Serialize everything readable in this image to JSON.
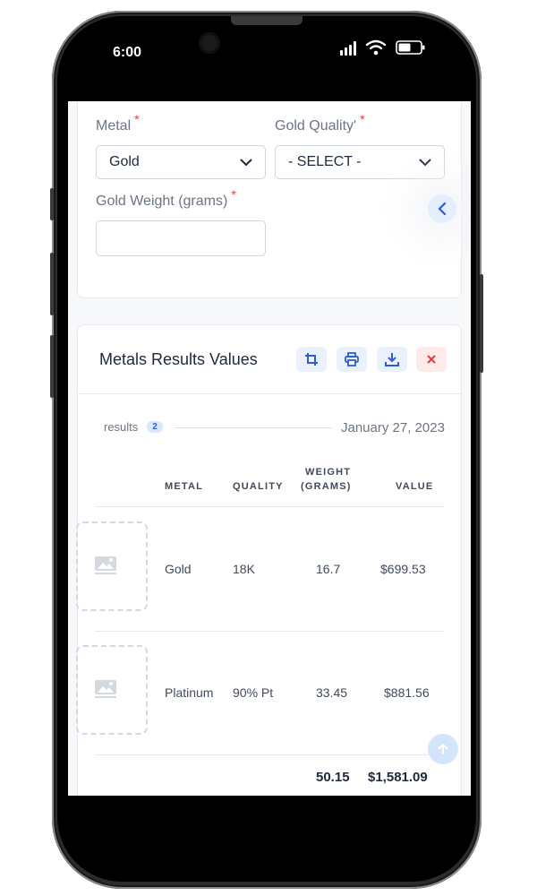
{
  "status_bar": {
    "time": "6:00"
  },
  "form": {
    "metal_label": "Metal",
    "metal_value": "Gold",
    "quality_label": "Gold Quality'",
    "quality_value": "- SELECT -",
    "weight_label": "Gold Weight (grams)",
    "weight_value": "",
    "required_mark": "*"
  },
  "results": {
    "title": "Metals Results Values",
    "count_label": "results",
    "count": "2",
    "date": "January 27, 2023",
    "toolbar": [
      "crop-icon",
      "print-icon",
      "download-icon",
      "close-icon"
    ],
    "columns": {
      "metal": "METAL",
      "quality": "QUALITY",
      "weight_line1": "WEIGHT",
      "weight_line2": "(GRAMS)",
      "value": "VALUE"
    },
    "rows": [
      {
        "metal": "Gold",
        "quality": "18K",
        "weight": "16.7",
        "value": "$699.53"
      },
      {
        "metal": "Platinum",
        "quality": "90% Pt",
        "weight": "33.45",
        "value": "$881.56"
      }
    ],
    "totals": {
      "weight": "50.15",
      "value": "$1,581.09"
    }
  },
  "colors": {
    "accent": "#2c5ecf",
    "danger": "#e23b3b",
    "required": "#e23b3b"
  }
}
